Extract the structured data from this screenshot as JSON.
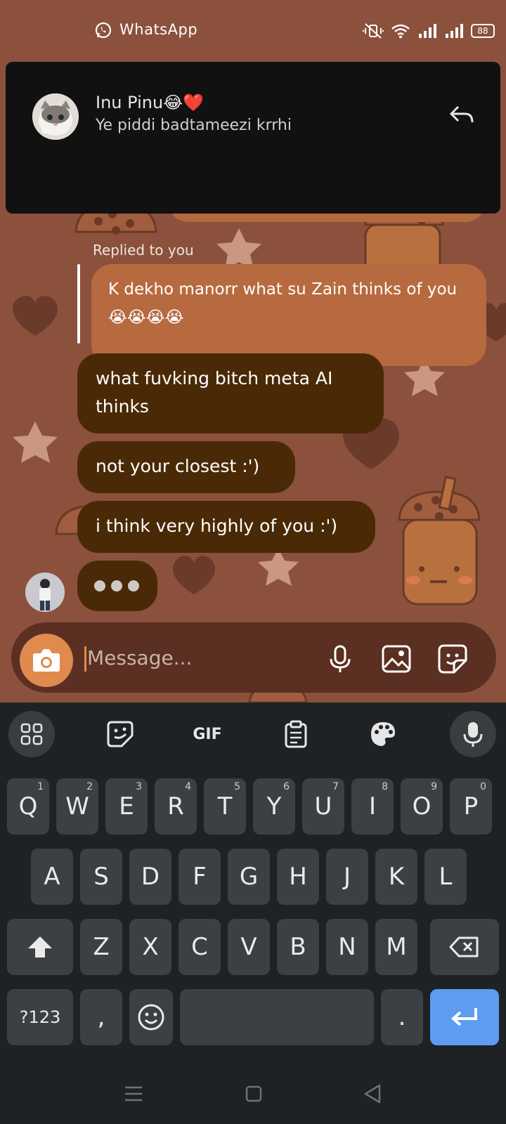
{
  "status_bar": {
    "app_name": "WhatsApp",
    "battery": "88"
  },
  "notification": {
    "sender": "Inu Pinu😂❤️",
    "message": "Ye piddi badtameezi krrhi"
  },
  "chat": {
    "replied_label": "Replied to you",
    "quoted_message": "K dekho manorr what su Zain thinks of you😭😭😭😭",
    "messages": [
      "what fuvking bitch meta AI thinks",
      "not your closest :')",
      "i think very highly of you :')"
    ]
  },
  "composer": {
    "placeholder": "Message..."
  },
  "keyboard": {
    "toolbar": {
      "gif_label": "GIF"
    },
    "row1": [
      {
        "key": "Q",
        "hint": "1"
      },
      {
        "key": "W",
        "hint": "2"
      },
      {
        "key": "E",
        "hint": "3"
      },
      {
        "key": "R",
        "hint": "4"
      },
      {
        "key": "T",
        "hint": "5"
      },
      {
        "key": "Y",
        "hint": "6"
      },
      {
        "key": "U",
        "hint": "7"
      },
      {
        "key": "I",
        "hint": "8"
      },
      {
        "key": "O",
        "hint": "9"
      },
      {
        "key": "P",
        "hint": "0"
      }
    ],
    "row2": [
      "A",
      "S",
      "D",
      "F",
      "G",
      "H",
      "J",
      "K",
      "L"
    ],
    "row3": [
      "Z",
      "X",
      "C",
      "V",
      "B",
      "N",
      "M"
    ],
    "bottom": {
      "symbols": "?123",
      "comma": ",",
      "period": "."
    }
  },
  "colors": {
    "wallpaper": "#8b513c",
    "sent_bubble": "#4a2a06",
    "quoted_bubble": "#b76a3f",
    "accent": "#e08a4e",
    "enter_key": "#5e9cf2"
  }
}
